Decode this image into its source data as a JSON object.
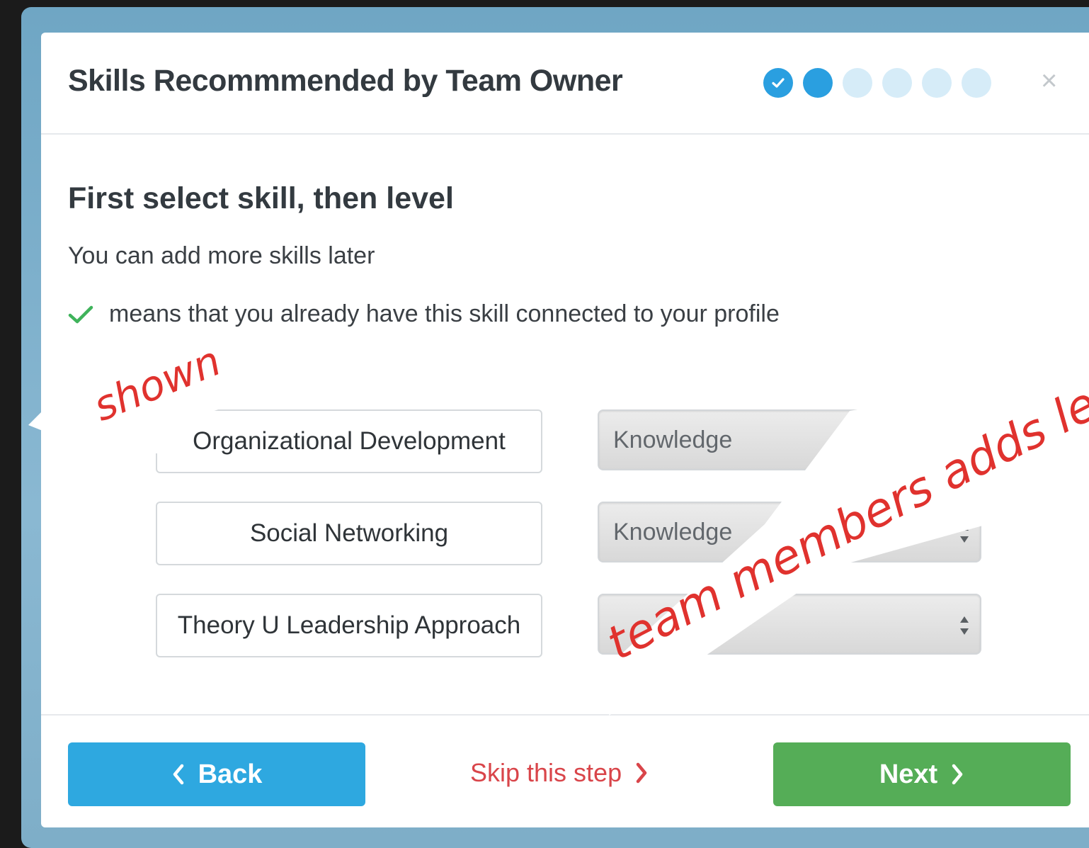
{
  "modal": {
    "title": "Skills Recommmended by Team Owner",
    "close_label": "×",
    "steps": [
      "done",
      "current",
      "pending",
      "pending",
      "pending",
      "pending"
    ]
  },
  "body": {
    "heading": "First select skill, then level",
    "subheading": "You can add more skills later",
    "legend_text": "means that you already have this skill connected to your profile",
    "legend_icon": "green-check-icon"
  },
  "skills": [
    {
      "name": "Organizational Development",
      "level": "Knowledge"
    },
    {
      "name": "Social Networking",
      "level": "Knowledge"
    },
    {
      "name": "Theory U Leadership Approach",
      "level": ""
    }
  ],
  "footer": {
    "back_label": "Back",
    "skip_label": "Skip this step",
    "next_label": "Next"
  },
  "annotations": {
    "shown": "shown",
    "team_members": "team members adds le"
  },
  "colors": {
    "primary": "#2ea8e0",
    "success": "#55ad57",
    "danger": "#d9454a",
    "annotation": "#e0322e"
  }
}
